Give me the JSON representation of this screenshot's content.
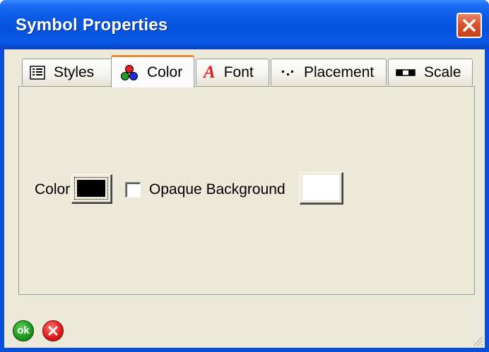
{
  "window": {
    "title": "Symbol Properties"
  },
  "tabs": [
    {
      "label": "Styles",
      "icon": "list-icon",
      "active": false
    },
    {
      "label": "Color",
      "icon": "rgb-circles-icon",
      "active": true
    },
    {
      "label": "Font",
      "icon": "font-a-icon",
      "active": false
    },
    {
      "label": "Placement",
      "icon": "placement-dots-icon",
      "active": false
    },
    {
      "label": "Scale",
      "icon": "scale-bar-icon",
      "active": false
    }
  ],
  "color_tab": {
    "color_label": "Color",
    "color_value": "#000000",
    "opaque_label": "Opaque Background",
    "opaque_checked": false,
    "background_value": "#ffffff"
  },
  "footer": {
    "ok_label": "ok",
    "ok_icon": "ok-icon",
    "cancel_icon": "cancel-x-icon"
  },
  "colors": {
    "title_bar": "#0a5ae6",
    "dialog_face": "#ece9d8",
    "active_tab_accent": "#e68b2c",
    "close_button": "#d9542f",
    "ok_green": "#1f9a1f",
    "cancel_red": "#e01c1c"
  }
}
